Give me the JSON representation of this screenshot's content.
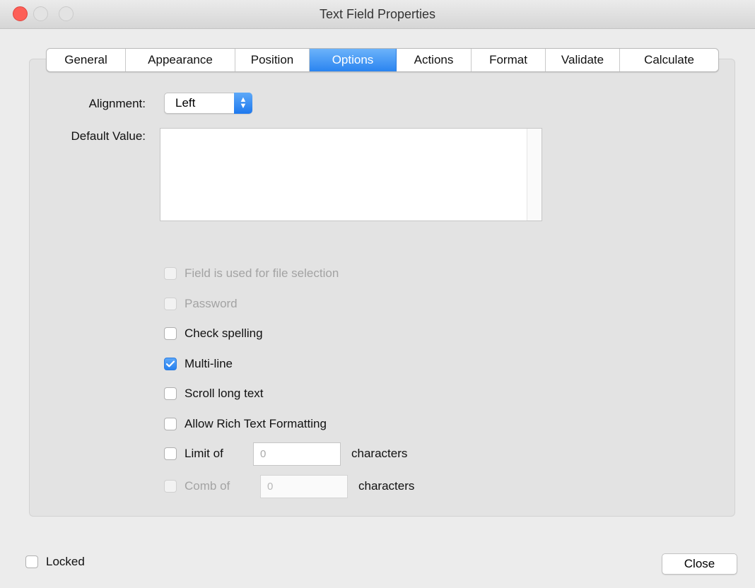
{
  "window": {
    "title": "Text Field Properties"
  },
  "tabs": [
    {
      "label": "General"
    },
    {
      "label": "Appearance"
    },
    {
      "label": "Position"
    },
    {
      "label": "Options",
      "active": true
    },
    {
      "label": "Actions"
    },
    {
      "label": "Format"
    },
    {
      "label": "Validate"
    },
    {
      "label": "Calculate"
    }
  ],
  "options": {
    "alignment_label": "Alignment:",
    "alignment_value": "Left",
    "default_value_label": "Default Value:",
    "default_value": "",
    "checkboxes": {
      "file_selection": {
        "label": "Field is used for file selection",
        "checked": false,
        "disabled": true
      },
      "password": {
        "label": "Password",
        "checked": false,
        "disabled": true
      },
      "check_spelling": {
        "label": "Check spelling",
        "checked": false,
        "disabled": false
      },
      "multi_line": {
        "label": "Multi-line",
        "checked": true,
        "disabled": false
      },
      "scroll_long_text": {
        "label": "Scroll long text",
        "checked": false,
        "disabled": false
      },
      "rich_text": {
        "label": "Allow Rich Text Formatting",
        "checked": false,
        "disabled": false
      },
      "limit_of": {
        "label": "Limit of",
        "checked": false,
        "disabled": false,
        "value": "0",
        "suffix": "characters"
      },
      "comb_of": {
        "label": "Comb of",
        "checked": false,
        "disabled": true,
        "value": "0",
        "suffix": "characters"
      }
    }
  },
  "footer": {
    "locked_label": "Locked",
    "locked_checked": false,
    "close_label": "Close"
  },
  "colors": {
    "accent": "#2a84f0",
    "close_light": "#fd5f57"
  }
}
